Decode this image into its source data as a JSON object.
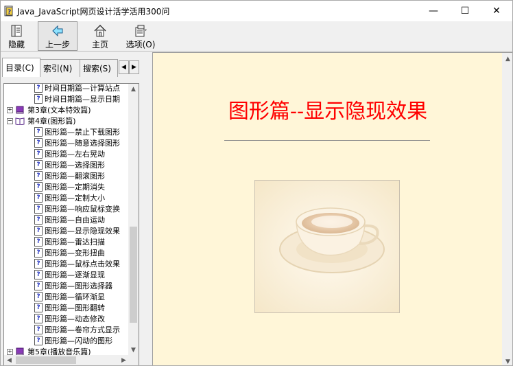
{
  "window": {
    "title": "Java_JavaScript网页设计活学活用300问",
    "controls": {
      "minimize": "—",
      "maximize": "☐",
      "close": "✕"
    }
  },
  "toolbar": {
    "buttons": [
      {
        "label": "隐藏",
        "icon": "hide-icon"
      },
      {
        "label": "上一步",
        "icon": "back-arrow-icon"
      },
      {
        "label": "主页",
        "icon": "home-icon"
      },
      {
        "label": "选项(O)",
        "icon": "options-icon"
      }
    ]
  },
  "sidebar": {
    "tabs": [
      {
        "label": "目录(C)"
      },
      {
        "label": "索引(N)"
      },
      {
        "label": "搜索(S)"
      }
    ],
    "tab_arrows": {
      "left": "◀",
      "right": "▶"
    },
    "tree": [
      {
        "type": "topic",
        "label": "时间日期篇—计算站点"
      },
      {
        "type": "topic",
        "label": "时间日期篇—显示日期"
      },
      {
        "type": "chapter",
        "state": "collapsed",
        "expander": "+",
        "label": "第3章(文本特效篇)"
      },
      {
        "type": "chapter",
        "state": "expanded",
        "expander": "−",
        "label": "第4章(图形篇)"
      },
      {
        "type": "topic",
        "label": "图形篇—禁止下载图形"
      },
      {
        "type": "topic",
        "label": "图形篇—随意选择图形"
      },
      {
        "type": "topic",
        "label": "图形篇—左右晃动"
      },
      {
        "type": "topic",
        "label": "图形篇—选择图形"
      },
      {
        "type": "topic",
        "label": "图形篇—翻滚图形"
      },
      {
        "type": "topic",
        "label": "图形篇—定期消失"
      },
      {
        "type": "topic",
        "label": "图形篇—定制大小"
      },
      {
        "type": "topic",
        "label": "图形篇—响应鼠标变换"
      },
      {
        "type": "topic",
        "label": "图形篇—自由运动"
      },
      {
        "type": "topic",
        "label": "图形篇—显示隐现效果"
      },
      {
        "type": "topic",
        "label": "图形篇—雷达扫描"
      },
      {
        "type": "topic",
        "label": "图形篇—变形扭曲"
      },
      {
        "type": "topic",
        "label": "图形篇—鼠标点击效果"
      },
      {
        "type": "topic",
        "label": "图形篇—逐渐显现"
      },
      {
        "type": "topic",
        "label": "图形篇—图形选择器"
      },
      {
        "type": "topic",
        "label": "图形篇—循环渐显"
      },
      {
        "type": "topic",
        "label": "图形篇—图形翻转"
      },
      {
        "type": "topic",
        "label": "图形篇—动态修改"
      },
      {
        "type": "topic",
        "label": "图形篇—卷帘方式显示"
      },
      {
        "type": "topic",
        "label": "图形篇—闪动的图形"
      },
      {
        "type": "chapter",
        "state": "collapsed",
        "expander": "+",
        "label": "第5章(播放音乐篇)"
      }
    ],
    "page_icon_glyph": "?"
  },
  "content": {
    "title": "图形篇--显示隐现效果",
    "background": "#fff6d8",
    "title_color": "#ff0000"
  },
  "scroll_glyphs": {
    "up": "▲",
    "down": "▼",
    "left": "◀",
    "right": "▶"
  }
}
